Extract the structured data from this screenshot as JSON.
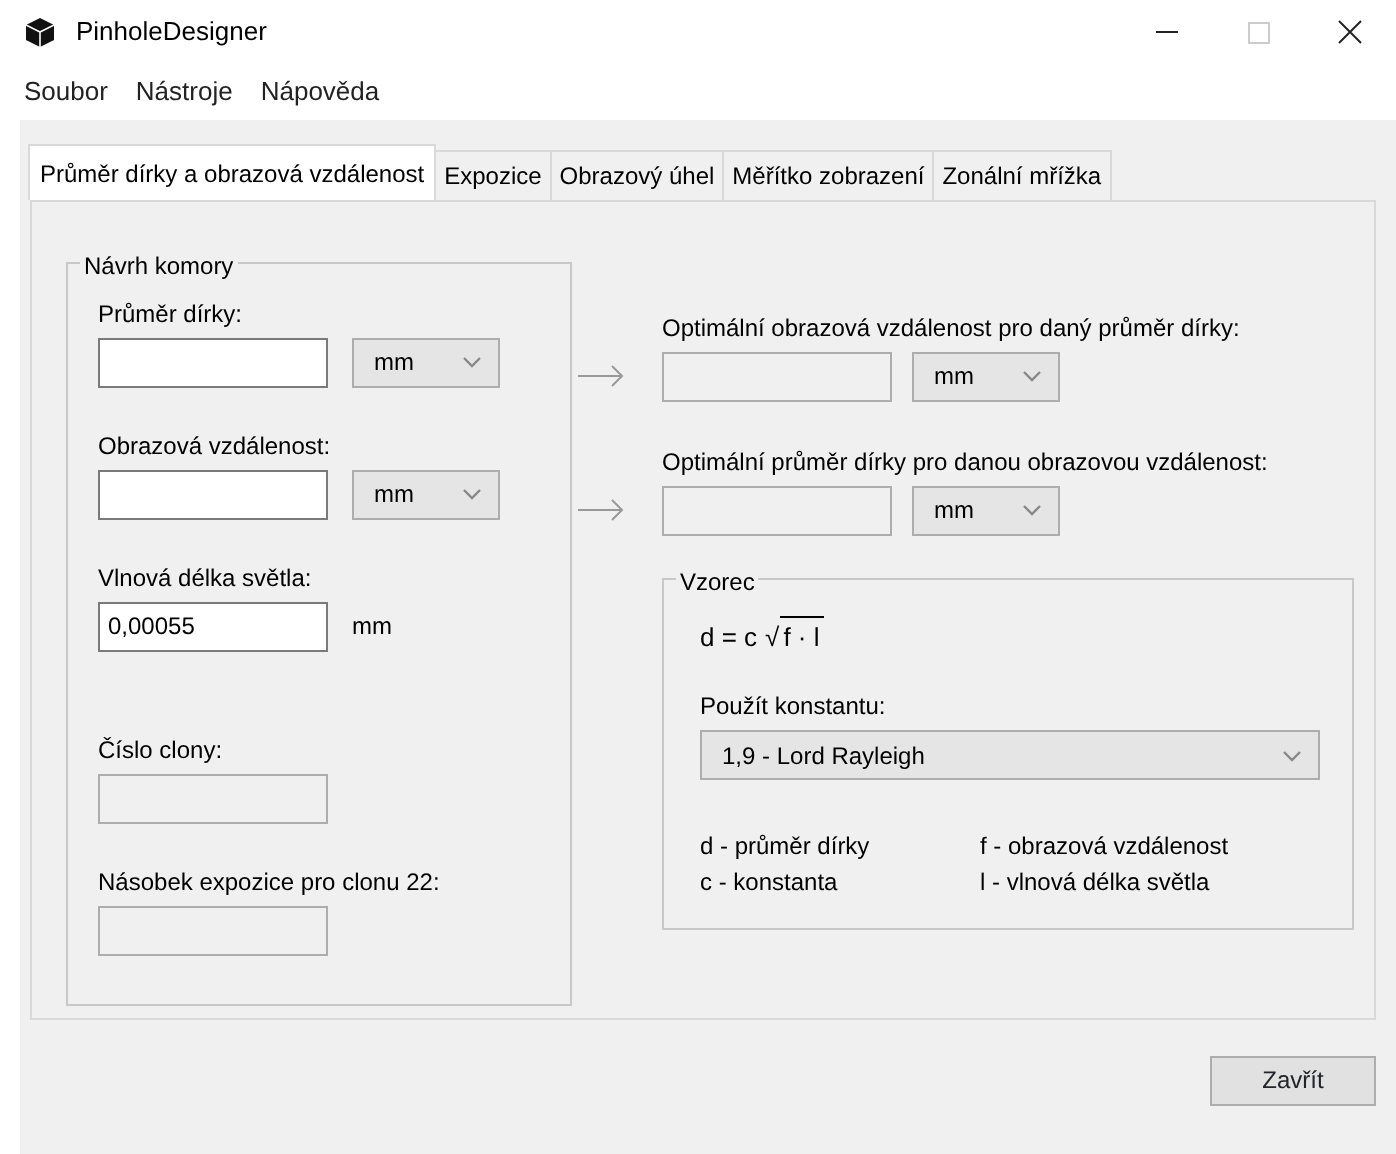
{
  "window": {
    "title": "PinholeDesigner"
  },
  "menu": [
    "Soubor",
    "Nástroje",
    "Nápověda"
  ],
  "tabs": [
    {
      "label": "Průměr dírky a obrazová vzdálenost",
      "selected": true
    },
    {
      "label": "Expozice",
      "selected": false
    },
    {
      "label": "Obrazový úhel",
      "selected": false
    },
    {
      "label": "Měřítko zobrazení",
      "selected": false
    },
    {
      "label": "Zonální mřížka",
      "selected": false
    }
  ],
  "camera_design": {
    "title": "Návrh komory",
    "fields": [
      {
        "kind": "select",
        "label": "Průměr dírky:",
        "unit": "mm"
      },
      {
        "kind": "select",
        "label": "Obrazová vzdálenost:",
        "unit": "mm"
      },
      {
        "kind": "text",
        "label": "Vlnová délka světla:",
        "value": "0,00055",
        "unit": "mm"
      },
      {
        "kind": "readonly",
        "label": "Číslo clony:"
      },
      {
        "kind": "readonly",
        "label": "Násobek expozice pro clonu 22:"
      }
    ]
  },
  "results": [
    {
      "label": "Optimální obrazová vzdálenost pro daný průměr dírky:",
      "unit": "mm"
    },
    {
      "label": "Optimální průměr dírky pro danou obrazovou vzdálenost:",
      "unit": "mm"
    }
  ],
  "formula": {
    "title": "Vzorec",
    "lhs": "d = c",
    "radical": "√",
    "radicand": "f · l",
    "constant_label": "Použít konstantu:",
    "constant": "1,9 - Lord Rayleigh",
    "legend": [
      [
        "d - průměr dírky",
        "f - obrazová vzdálenost"
      ],
      [
        "c - konstanta",
        "l - vlnová délka světla"
      ]
    ]
  },
  "close_button": "Zavřít"
}
